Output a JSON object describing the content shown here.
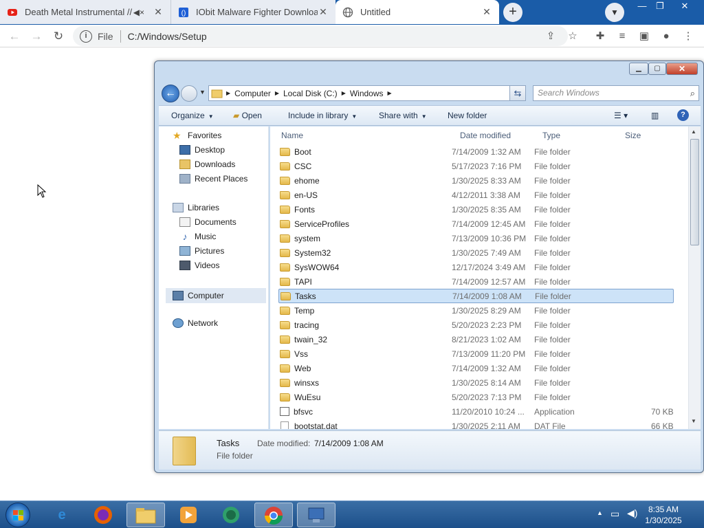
{
  "browser": {
    "tabs": [
      {
        "title": "Death Metal Instrumental //",
        "favicon": "youtube-icon",
        "muted_icon": "speaker-muted-icon"
      },
      {
        "title": "IObit Malware Fighter Downloads",
        "favicon": "iobit-icon"
      },
      {
        "title": "Untitled",
        "favicon": "globe-icon"
      }
    ],
    "new_tab_label": "+",
    "omnibox": {
      "scheme_label": "File",
      "url": "C:/Windows/Setup"
    }
  },
  "explorer": {
    "breadcrumb": [
      "Computer",
      "Local Disk (C:)",
      "Windows"
    ],
    "search_placeholder": "Search Windows",
    "commands": {
      "organize": "Organize",
      "open": "Open",
      "include": "Include in library",
      "share": "Share with",
      "new_folder": "New folder"
    },
    "nav": {
      "favorites": "Favorites",
      "desktop": "Desktop",
      "downloads": "Downloads",
      "recent": "Recent Places",
      "libraries": "Libraries",
      "documents": "Documents",
      "music": "Music",
      "pictures": "Pictures",
      "videos": "Videos",
      "computer": "Computer",
      "network": "Network"
    },
    "columns": {
      "name": "Name",
      "date": "Date modified",
      "type": "Type",
      "size": "Size"
    },
    "files": [
      {
        "name": "Boot",
        "date": "7/14/2009 1:32 AM",
        "type": "File folder",
        "size": "",
        "kind": "folder"
      },
      {
        "name": "CSC",
        "date": "5/17/2023 7:16 PM",
        "type": "File folder",
        "size": "",
        "kind": "folder"
      },
      {
        "name": "ehome",
        "date": "1/30/2025 8:33 AM",
        "type": "File folder",
        "size": "",
        "kind": "folder"
      },
      {
        "name": "en-US",
        "date": "4/12/2011 3:38 AM",
        "type": "File folder",
        "size": "",
        "kind": "folder"
      },
      {
        "name": "Fonts",
        "date": "1/30/2025 8:35 AM",
        "type": "File folder",
        "size": "",
        "kind": "folder"
      },
      {
        "name": "ServiceProfiles",
        "date": "7/14/2009 12:45 AM",
        "type": "File folder",
        "size": "",
        "kind": "folder"
      },
      {
        "name": "system",
        "date": "7/13/2009 10:36 PM",
        "type": "File folder",
        "size": "",
        "kind": "folder"
      },
      {
        "name": "System32",
        "date": "1/30/2025 7:49 AM",
        "type": "File folder",
        "size": "",
        "kind": "folder"
      },
      {
        "name": "SysWOW64",
        "date": "12/17/2024 3:49 AM",
        "type": "File folder",
        "size": "",
        "kind": "folder"
      },
      {
        "name": "TAPI",
        "date": "7/14/2009 12:57 AM",
        "type": "File folder",
        "size": "",
        "kind": "folder"
      },
      {
        "name": "Tasks",
        "date": "7/14/2009 1:08 AM",
        "type": "File folder",
        "size": "",
        "kind": "folder",
        "selected": true
      },
      {
        "name": "Temp",
        "date": "1/30/2025 8:29 AM",
        "type": "File folder",
        "size": "",
        "kind": "folder"
      },
      {
        "name": "tracing",
        "date": "5/20/2023 2:23 PM",
        "type": "File folder",
        "size": "",
        "kind": "folder"
      },
      {
        "name": "twain_32",
        "date": "8/21/2023 1:02 AM",
        "type": "File folder",
        "size": "",
        "kind": "folder"
      },
      {
        "name": "Vss",
        "date": "7/13/2009 11:20 PM",
        "type": "File folder",
        "size": "",
        "kind": "folder"
      },
      {
        "name": "Web",
        "date": "7/14/2009 1:32 AM",
        "type": "File folder",
        "size": "",
        "kind": "folder"
      },
      {
        "name": "winsxs",
        "date": "1/30/2025 8:14 AM",
        "type": "File folder",
        "size": "",
        "kind": "folder"
      },
      {
        "name": "WuEsu",
        "date": "5/20/2023 7:13 PM",
        "type": "File folder",
        "size": "",
        "kind": "folder"
      },
      {
        "name": "bfsvc",
        "date": "11/20/2010 10:24 ...",
        "type": "Application",
        "size": "70 KB",
        "kind": "app"
      },
      {
        "name": "bootstat.dat",
        "date": "1/30/2025 2:11 AM",
        "type": "DAT File",
        "size": "66 KB",
        "kind": "file"
      }
    ],
    "details": {
      "name": "Tasks",
      "date_label": "Date modified:",
      "date_value": "7/14/2009 1:08 AM",
      "type": "File folder"
    }
  },
  "taskbar": {
    "clock_time": "8:35 AM",
    "clock_date": "1/30/2025",
    "tray_up_icon": "▲"
  },
  "colors": {
    "accent": "#1a5ca8",
    "selection": "#cde3f8"
  }
}
